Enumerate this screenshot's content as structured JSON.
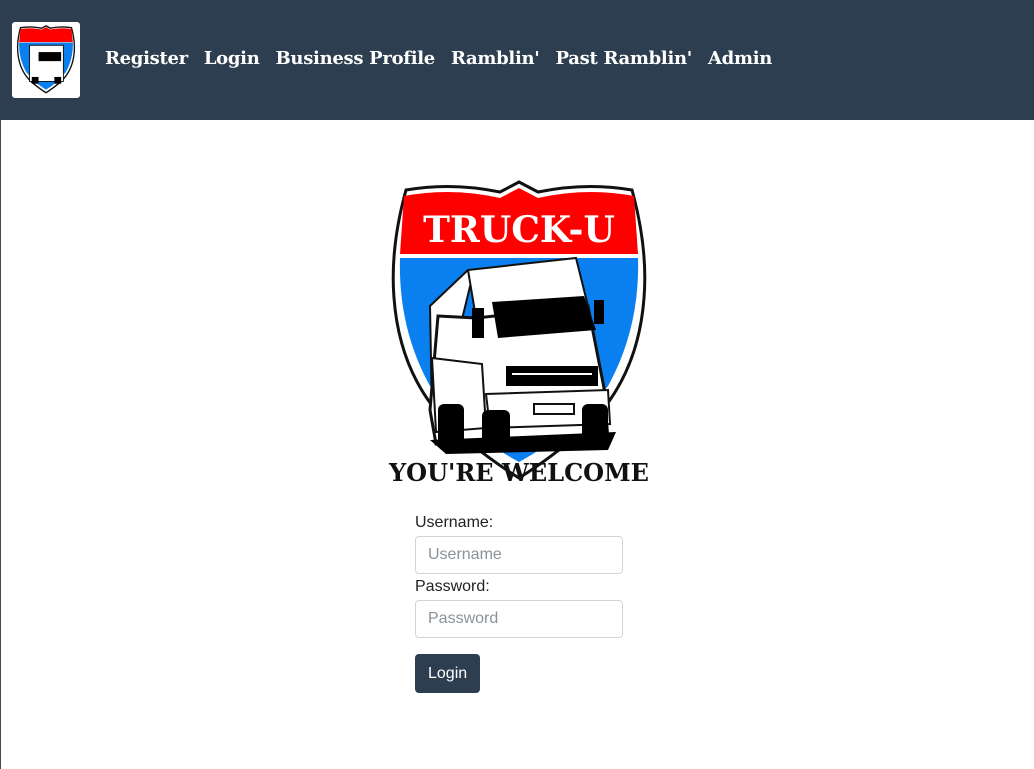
{
  "navbar": {
    "background_color": "#2c3e50",
    "logo": {
      "title": "TRUCK-U",
      "tagline": "YOU'RE WELCOME"
    },
    "links": [
      {
        "label": "Register"
      },
      {
        "label": "Login"
      },
      {
        "label": "Business Profile"
      },
      {
        "label": "Ramblin'"
      },
      {
        "label": "Past Ramblin'"
      },
      {
        "label": "Admin"
      }
    ]
  },
  "hero_logo": {
    "title": "TRUCK-U",
    "tagline": "YOU'RE WELCOME",
    "colors": {
      "banner_red": "#ff0000",
      "shield_blue": "#0a7ff0",
      "outline": "#111111"
    }
  },
  "login_form": {
    "username_label": "Username:",
    "username_placeholder": "Username",
    "username_value": "",
    "password_label": "Password:",
    "password_placeholder": "Password",
    "password_value": "",
    "submit_label": "Login"
  }
}
